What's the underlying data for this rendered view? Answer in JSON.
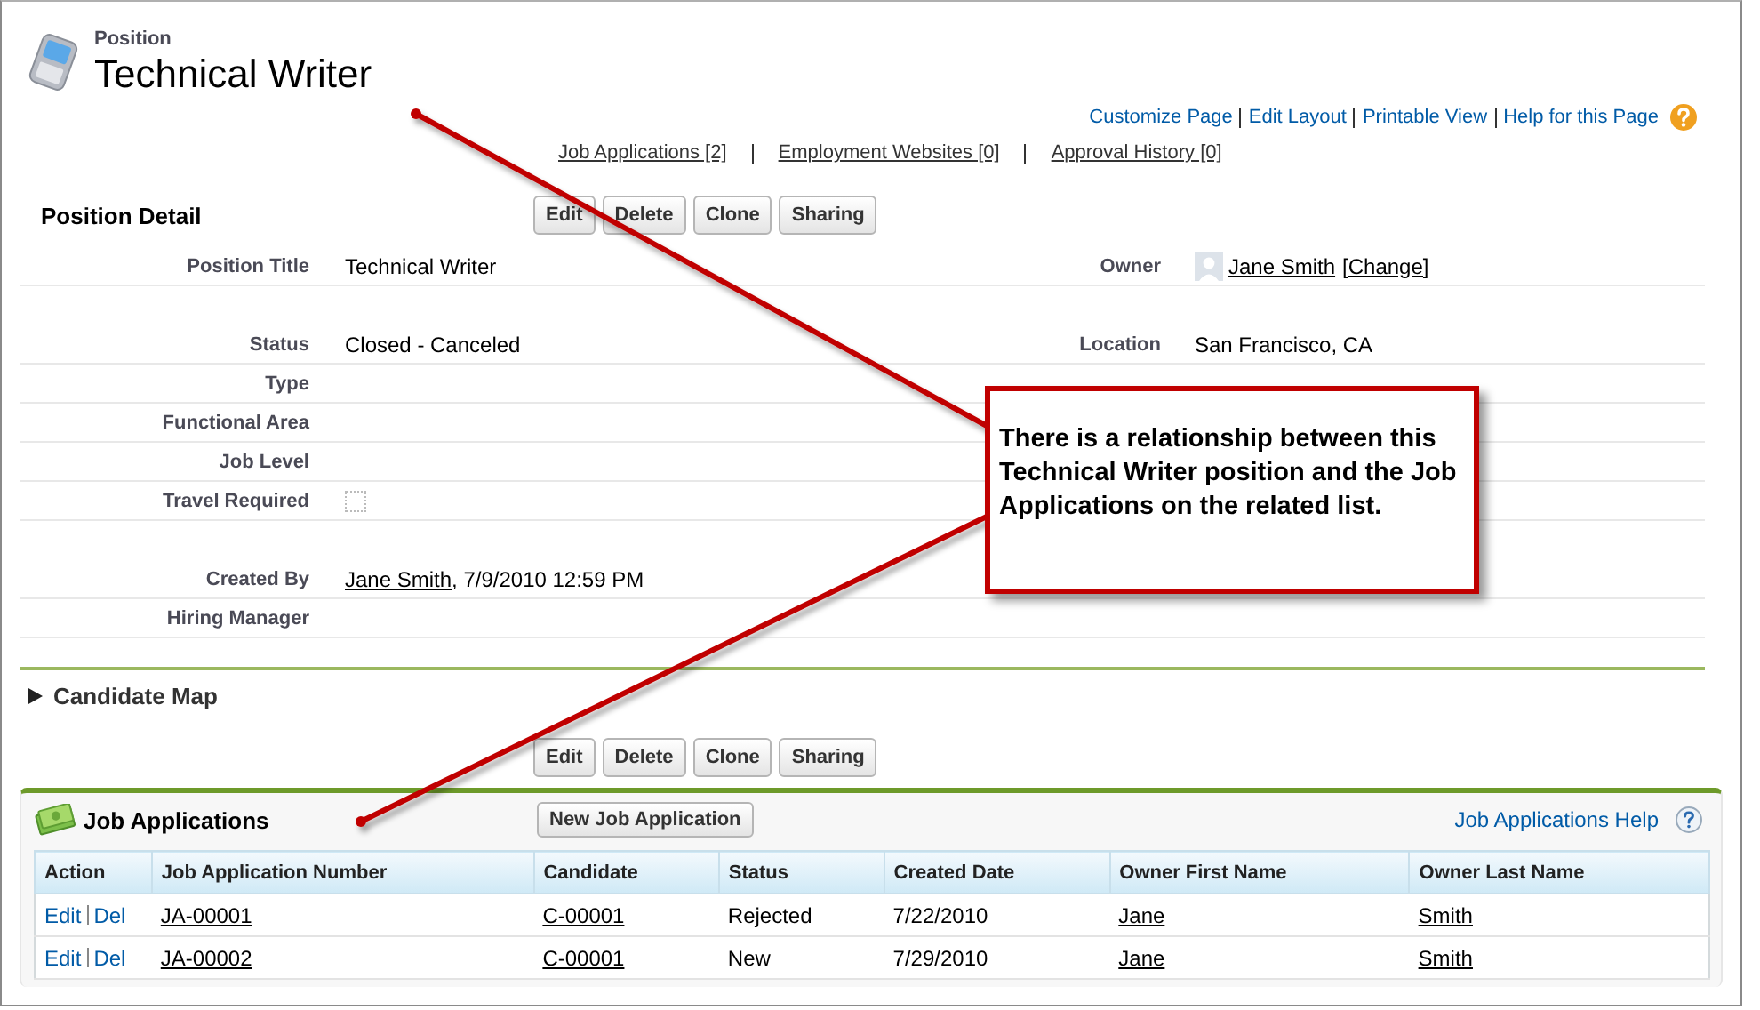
{
  "header": {
    "object_type": "Position",
    "title": "Technical Writer"
  },
  "top_links": [
    "Customize Page",
    "Edit Layout",
    "Printable View",
    "Help for this Page"
  ],
  "related_links": [
    "Job Applications [2]",
    "Employment Websites [0]",
    "Approval History [0]"
  ],
  "detail": {
    "title": "Position Detail",
    "buttons": [
      "Edit",
      "Delete",
      "Clone",
      "Sharing"
    ],
    "sections": [
      [
        {
          "left": {
            "label": "Position Title",
            "kind": "text",
            "value": "Technical Writer"
          },
          "right": {
            "label": "Owner",
            "kind": "owner",
            "link": "Jane Smith",
            "action": "[Change]"
          }
        }
      ],
      [
        {
          "left": {
            "label": "Status",
            "kind": "text",
            "value": "Closed - Canceled"
          },
          "right": {
            "label": "Location",
            "kind": "text",
            "value": "San Francisco, CA"
          }
        },
        {
          "left": {
            "label": "Type",
            "kind": "text"
          }
        },
        {
          "left": {
            "label": "Functional Area",
            "kind": "text"
          }
        },
        {
          "left": {
            "label": "Job Level",
            "kind": "text"
          }
        },
        {
          "left": {
            "label": "Travel Required",
            "kind": "checkbox",
            "checked": false
          }
        }
      ],
      [
        {
          "left": {
            "label": "Created By",
            "kind": "link_text",
            "link": "Jane Smith",
            "value": ", 7/9/2010 12:59 PM"
          }
        },
        {
          "left": {
            "label": "Hiring Manager",
            "kind": "text"
          }
        }
      ]
    ]
  },
  "collapsible": {
    "title": "Candidate Map",
    "expanded": false
  },
  "bottom_buttons": [
    "Edit",
    "Delete",
    "Clone",
    "Sharing"
  ],
  "related_list": {
    "title": "Job Applications",
    "button": "New Job Application",
    "help": "Job Applications Help",
    "columns": [
      {
        "label": "Action",
        "kind": "actions"
      },
      {
        "label": "Job Application Number",
        "kind": "link"
      },
      {
        "label": "Candidate",
        "kind": "link"
      },
      {
        "label": "Status",
        "kind": "text"
      },
      {
        "label": "Created Date",
        "kind": "text"
      },
      {
        "label": "Owner First Name",
        "kind": "link"
      },
      {
        "label": "Owner Last Name",
        "kind": "link"
      }
    ],
    "rows": [
      {
        "cells": [
          [
            "Edit",
            "Del"
          ],
          "JA-00001",
          "C-00001",
          "Rejected",
          "7/22/2010",
          "Jane",
          "Smith"
        ]
      },
      {
        "cells": [
          [
            "Edit",
            "Del"
          ],
          "JA-00002",
          "C-00001",
          "New",
          "7/29/2010",
          "Jane",
          "Smith"
        ]
      }
    ]
  },
  "callout": {
    "text": "There is a relationship between this Technical Writer position and the Job Applications on the related list."
  }
}
